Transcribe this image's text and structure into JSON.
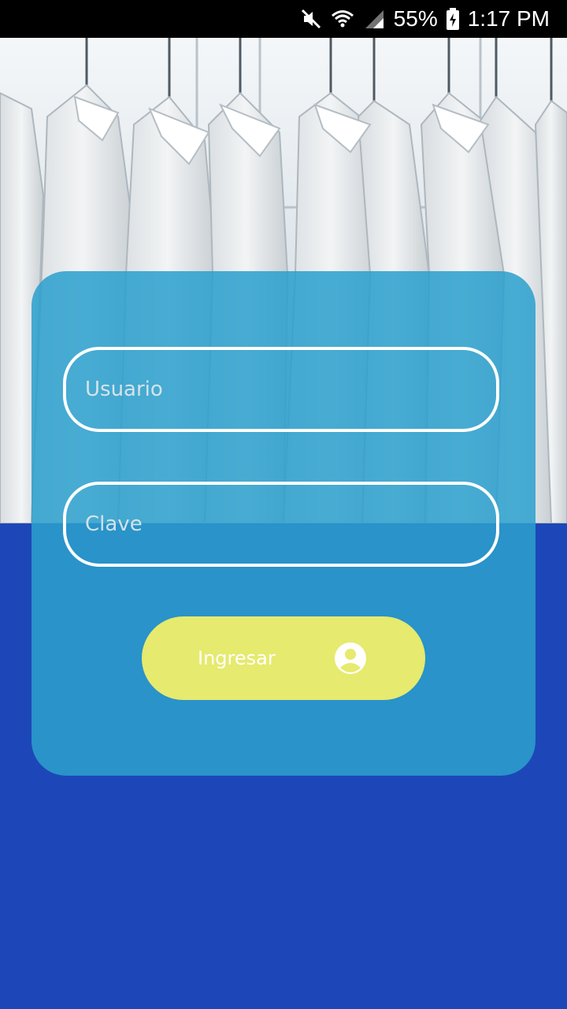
{
  "status_bar": {
    "battery": "55%",
    "time": "1:17 PM",
    "icons": [
      "mute-icon",
      "wifi-icon",
      "signal-icon",
      "battery-charging-icon"
    ]
  },
  "hero": {
    "image": "shirts-on-hangers-photo"
  },
  "login_form": {
    "username_placeholder": "Usuario",
    "password_placeholder": "Clave",
    "submit_label": "Ingresar",
    "submit_icon": "account-circle-icon"
  },
  "colors": {
    "background": "#1d47b8",
    "card": "#2ba0cd",
    "button": "#e6ea6e",
    "field_border": "#ffffff"
  }
}
